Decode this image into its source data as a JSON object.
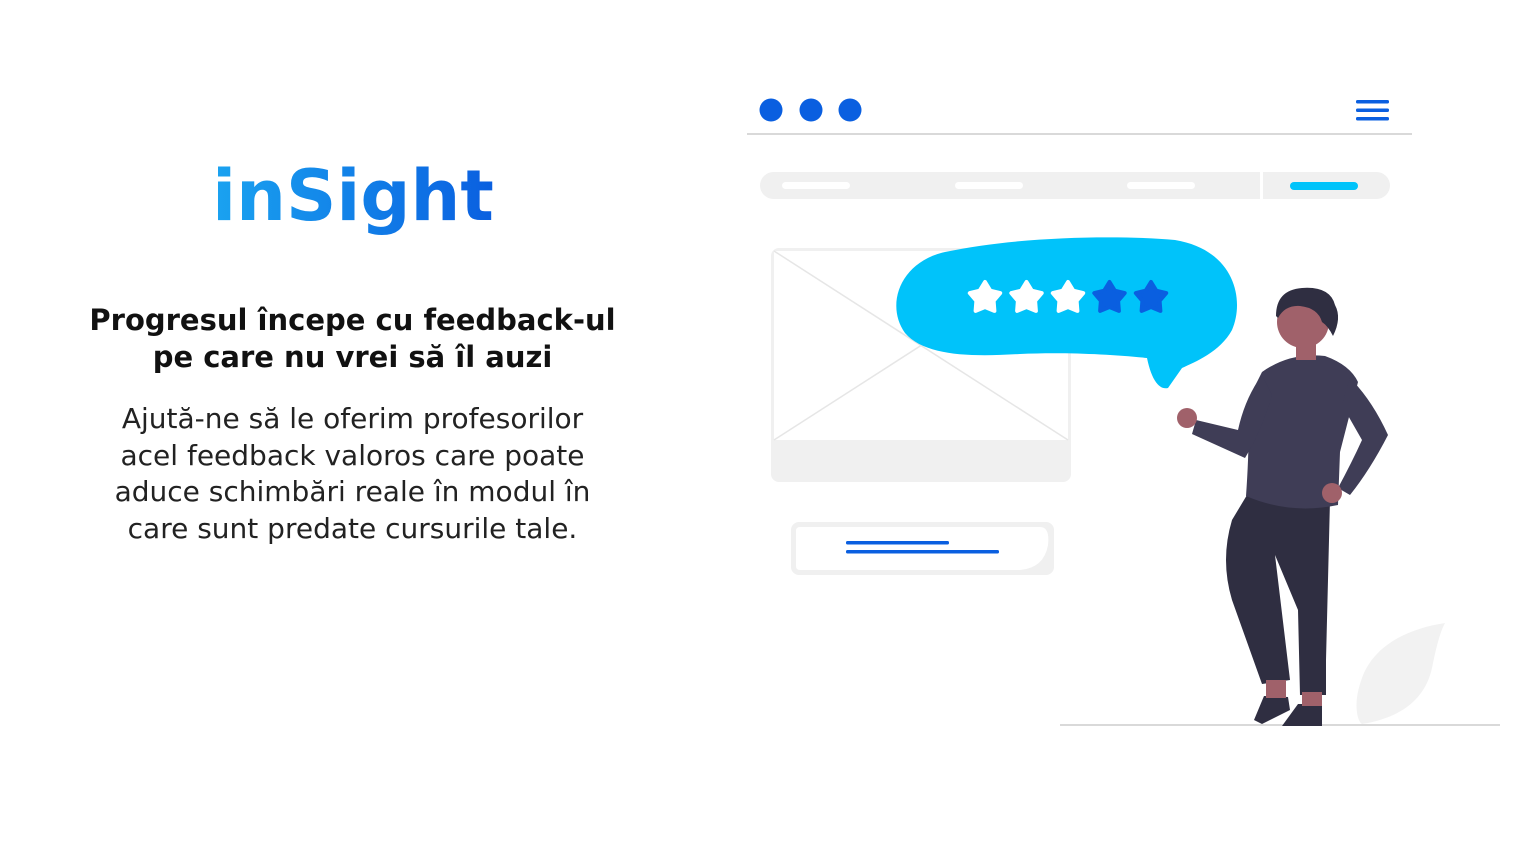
{
  "brand": {
    "logo_text": "inSight",
    "colors": {
      "logo_gradient_start": "#1aa3f0",
      "logo_gradient_end": "#0a5fe0",
      "accent": "#0a5fe0",
      "bubble": "#00c3fa",
      "light_gray": "#f0f0f0",
      "figure_shirt": "#3f3d56",
      "figure_pants": "#2f2e41",
      "skin": "#a0616a"
    }
  },
  "tagline": {
    "line1": "Progresul începe cu feedback-ul",
    "line2": "pe care nu vrei să îl auzi"
  },
  "description": {
    "line1": "Ajută-ne să le oferim profesorilor",
    "line2": "acel feedback valoros care poate",
    "line3": "aduce schimbări reale în modul în",
    "line4": "care sunt predate cursurile tale."
  },
  "illustration": {
    "browser_dots": [
      "window-dot",
      "window-dot",
      "window-dot"
    ],
    "menu_icon": "hamburger-menu-icon",
    "rating": {
      "filled_stars": 3,
      "total_stars": 5
    }
  }
}
